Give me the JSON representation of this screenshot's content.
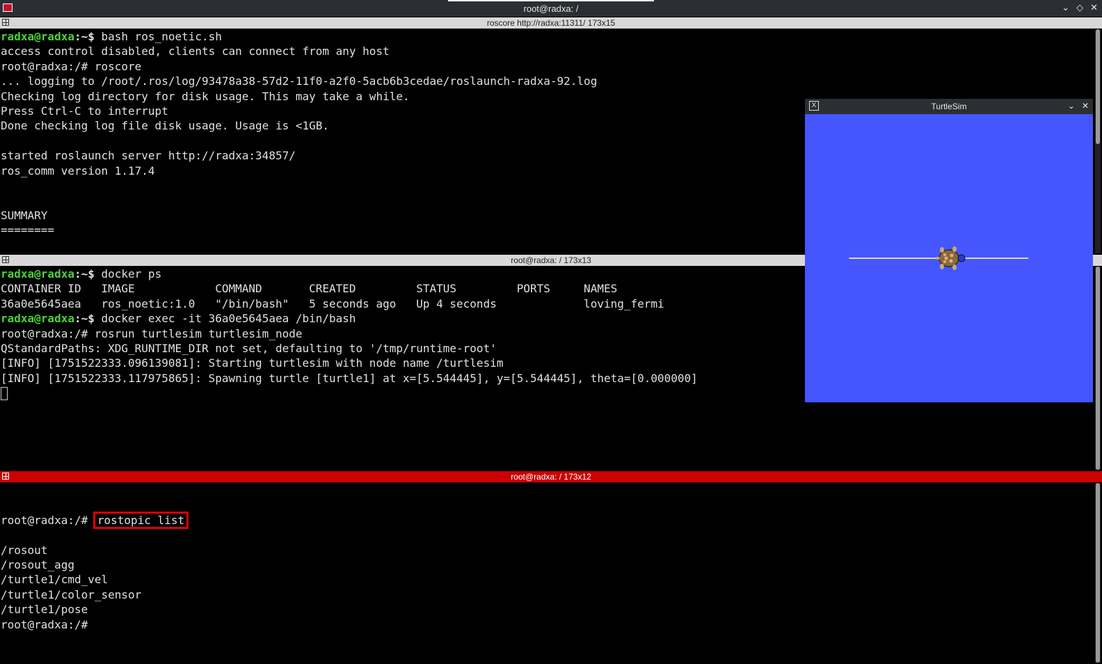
{
  "window": {
    "title": "root@radxa: /",
    "controls": {
      "minimize": "⌄",
      "maximize": "◇",
      "close": "✕"
    }
  },
  "panes": [
    {
      "header": "roscore http://radxa:11311/ 173x15",
      "lines": [
        {
          "prompt": "radxa@radxa",
          "path": ":~$ ",
          "text": "bash ros_noetic.sh"
        },
        {
          "text": "access control disabled, clients can connect from any host"
        },
        {
          "text": "root@radxa:/# roscore"
        },
        {
          "text": "... logging to /root/.ros/log/93478a38-57d2-11f0-a2f0-5acb6b3cedae/roslaunch-radxa-92.log"
        },
        {
          "text": "Checking log directory for disk usage. This may take a while."
        },
        {
          "text": "Press Ctrl-C to interrupt"
        },
        {
          "text": "Done checking log file disk usage. Usage is <1GB."
        },
        {
          "text": ""
        },
        {
          "text": "started roslaunch server http://radxa:34857/"
        },
        {
          "text": "ros_comm version 1.17.4"
        },
        {
          "text": ""
        },
        {
          "text": ""
        },
        {
          "text": "SUMMARY"
        },
        {
          "text": "========"
        }
      ]
    },
    {
      "header": "root@radxa: / 173x13",
      "lines": [
        {
          "prompt": "radxa@radxa",
          "path": ":~$ ",
          "text": "docker ps"
        },
        {
          "text": "CONTAINER ID   IMAGE            COMMAND       CREATED         STATUS         PORTS     NAMES"
        },
        {
          "text": "36a0e5645aea   ros_noetic:1.0   \"/bin/bash\"   5 seconds ago   Up 4 seconds             loving_fermi"
        },
        {
          "prompt": "radxa@radxa",
          "path": ":~$ ",
          "text": "docker exec -it 36a0e5645aea /bin/bash"
        },
        {
          "text": "root@radxa:/# rosrun turtlesim turtlesim_node"
        },
        {
          "text": "QStandardPaths: XDG_RUNTIME_DIR not set, defaulting to '/tmp/runtime-root'"
        },
        {
          "text": "[INFO] [1751522333.096139081]: Starting turtlesim with node name /turtlesim"
        },
        {
          "text": "[INFO] [1751522333.117975865]: Spawning turtle [turtle1] at x=[5.544445], y=[5.544445], theta=[0.000000]"
        }
      ]
    },
    {
      "header": "root@radxa: / 173x12",
      "prompt_root": "root@radxa:/# ",
      "command": "rostopic list",
      "lines": [
        {
          "text": "/rosout"
        },
        {
          "text": "/rosout_agg"
        },
        {
          "text": "/turtle1/cmd_vel"
        },
        {
          "text": "/turtle1/color_sensor"
        },
        {
          "text": "/turtle1/pose"
        },
        {
          "text": "root@radxa:/# "
        }
      ]
    }
  ],
  "turtlesim": {
    "title": "TurtleSim",
    "background": "#4556ff",
    "trail_color": "#d8d8d8",
    "turtle": {
      "x": 5.544445,
      "y": 5.544445,
      "theta": 0.0
    },
    "trail": {
      "x_start": 1.7,
      "x_end": 8.6,
      "y": 5.544445
    }
  },
  "colors": {
    "prompt_green": "#4cd137",
    "active_header": "#cc0000",
    "highlight": "#e00000"
  }
}
